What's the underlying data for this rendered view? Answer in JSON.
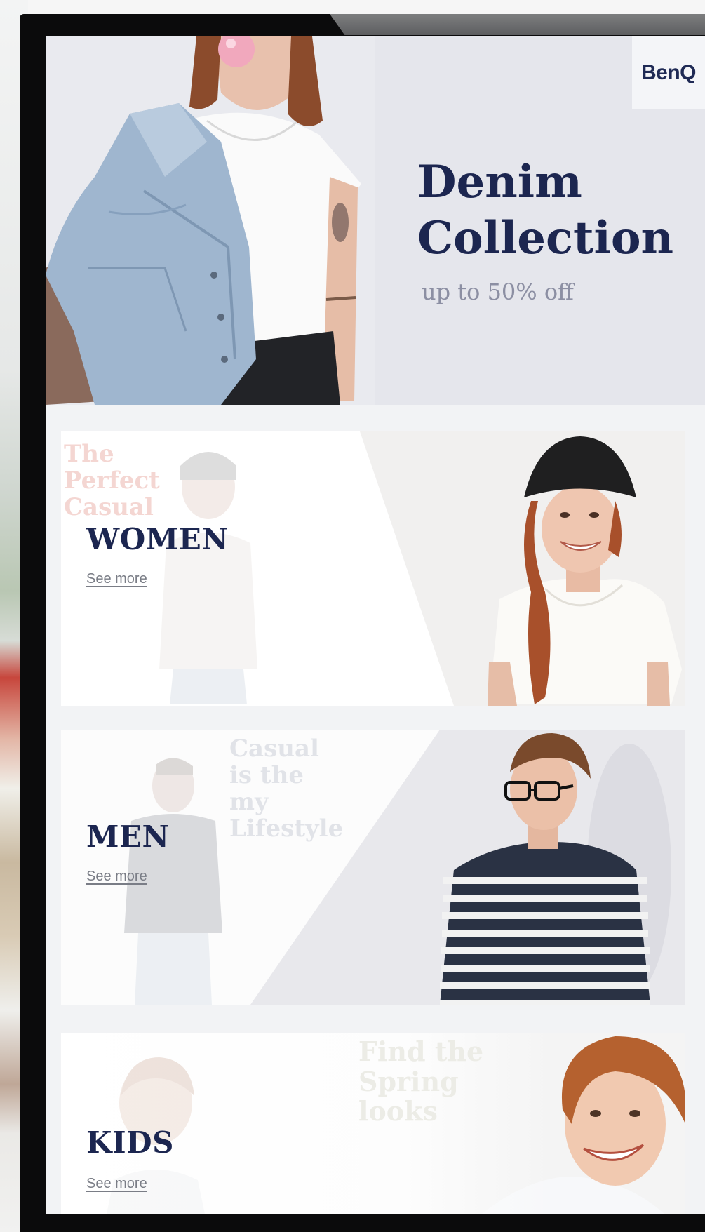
{
  "brand": "BenQ",
  "hero": {
    "title": "Denim\nCollection",
    "subtitle": "up to 50% off"
  },
  "categories": {
    "women": {
      "label": "WOMEN",
      "link": "See more",
      "tagline": "The\nPerfect\nCasual"
    },
    "men": {
      "label": "MEN",
      "link": "See more",
      "tagline": "Casual\nis the\nmy\nLifestyle"
    },
    "kids": {
      "label": "KIDS",
      "link": "See more",
      "tagline": "Find the\nSpring\nlooks"
    }
  },
  "colors": {
    "navy": "#1c2650",
    "hero_bg": "#e5e6ec",
    "muted": "#8c8fa3",
    "device_frame": "#0b0b0c"
  }
}
